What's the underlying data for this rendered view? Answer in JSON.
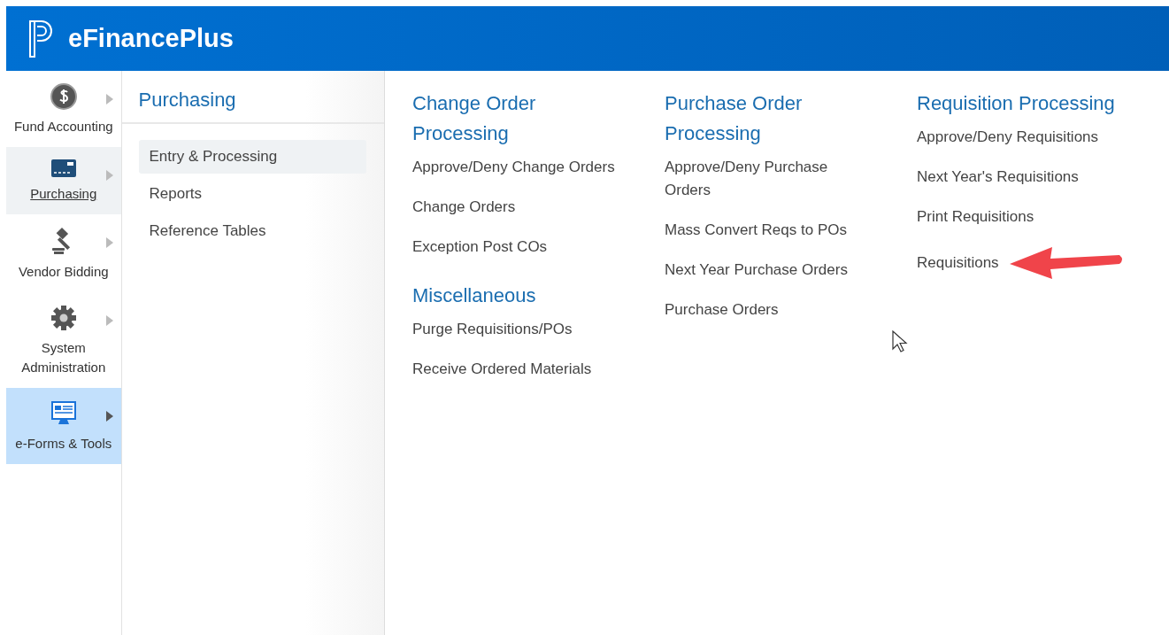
{
  "header": {
    "title": "eFinancePlus"
  },
  "sidebar": {
    "items": [
      {
        "kind": "dollar",
        "label": "Fund Accounting",
        "selected": false,
        "highlighted": false
      },
      {
        "kind": "card",
        "label": "Purchasing",
        "selected": true,
        "highlighted": false
      },
      {
        "kind": "gavel",
        "label": "Vendor Bidding",
        "selected": false,
        "highlighted": false
      },
      {
        "kind": "gear",
        "label": "System Administration",
        "selected": false,
        "highlighted": false
      },
      {
        "kind": "monitor",
        "label": "e-Forms & Tools",
        "selected": false,
        "highlighted": true
      }
    ]
  },
  "submenu": {
    "title": "Purchasing",
    "items": [
      {
        "label": "Entry & Processing",
        "selected": true
      },
      {
        "label": "Reports",
        "selected": false
      },
      {
        "label": "Reference Tables",
        "selected": false
      }
    ]
  },
  "columns": [
    {
      "sections": [
        {
          "title": "Change Order Processing",
          "links": [
            {
              "label": "Approve/Deny Change Orders",
              "arrow": false
            },
            {
              "label": "Change Orders",
              "arrow": false
            },
            {
              "label": "Exception Post COs",
              "arrow": false
            }
          ]
        },
        {
          "title": "Miscellaneous",
          "links": [
            {
              "label": "Purge Requisitions/POs",
              "arrow": false
            },
            {
              "label": "Receive Ordered Materials",
              "arrow": false
            }
          ]
        }
      ]
    },
    {
      "sections": [
        {
          "title": "Purchase Order Processing",
          "links": [
            {
              "label": "Approve/Deny Purchase Orders",
              "arrow": false
            },
            {
              "label": "Mass Convert Reqs to POs",
              "arrow": false
            },
            {
              "label": "Next Year Purchase Orders",
              "arrow": false
            },
            {
              "label": "Purchase Orders",
              "arrow": false
            }
          ]
        }
      ]
    },
    {
      "sections": [
        {
          "title": "Requisition Processing",
          "links": [
            {
              "label": "Approve/Deny Requisitions",
              "arrow": false
            },
            {
              "label": "Next Year's Requisitions",
              "arrow": false
            },
            {
              "label": "Print Requisitions",
              "arrow": false
            },
            {
              "label": "Requisitions",
              "arrow": true
            }
          ]
        }
      ]
    }
  ]
}
